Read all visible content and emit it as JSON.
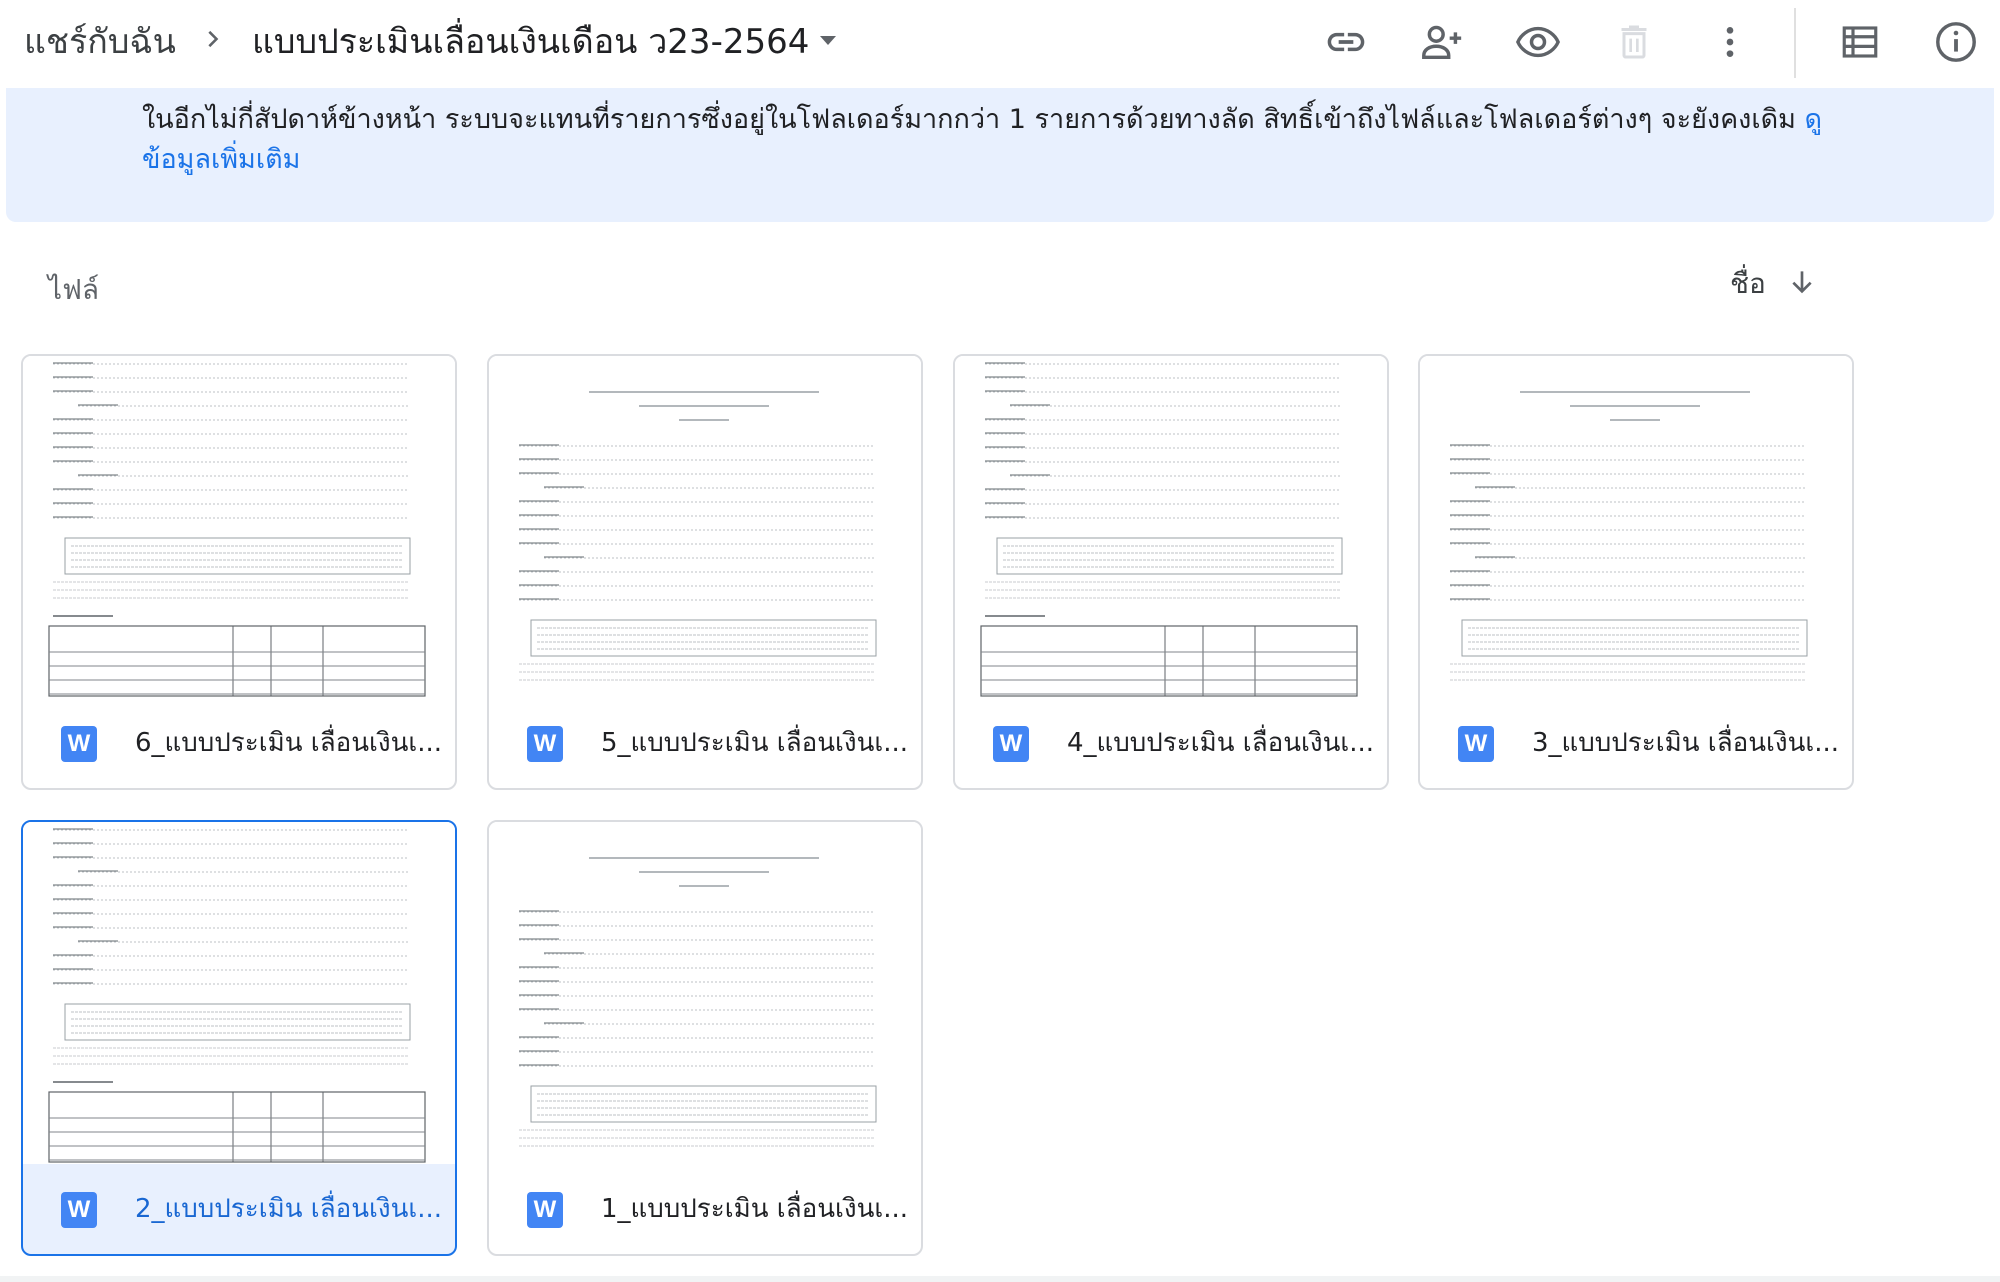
{
  "breadcrumb": {
    "root": "แชร์กับฉัน",
    "current": "แบบประเมินเลื่อนเงินเดือน ว23-2564"
  },
  "toolbar": {
    "icons": [
      "link-icon",
      "add-person-icon",
      "eye-icon",
      "trash-icon",
      "more-vert-icon",
      "list-view-icon",
      "info-icon"
    ]
  },
  "banner": {
    "text": "ในอีกไม่กี่สัปดาห์ข้างหน้า ระบบจะแทนที่รายการซึ่งอยู่ในโฟลเดอร์มากกว่า 1 รายการด้วยทางลัด สิทธิ์เข้าถึงไฟล์และโฟลเดอร์ต่างๆ จะยังคงเดิม ",
    "link": "ดูข้อมูลเพิ่มเติม"
  },
  "section": {
    "label": "ไฟล์",
    "sort_label": "ชื่อ"
  },
  "files": [
    {
      "name": "6_แบบประเมิน เลื่อนเงินเ...",
      "icon_letter": "W",
      "selected": false
    },
    {
      "name": "5_แบบประเมิน เลื่อนเงินเ...",
      "icon_letter": "W",
      "selected": false
    },
    {
      "name": "4_แบบประเมิน เลื่อนเงินเ...",
      "icon_letter": "W",
      "selected": false
    },
    {
      "name": "3_แบบประเมิน เลื่อนเงินเ...",
      "icon_letter": "W",
      "selected": false
    },
    {
      "name": "2_แบบประเมิน เลื่อนเงินเ...",
      "icon_letter": "W",
      "selected": true
    },
    {
      "name": "1_แบบประเมิน เลื่อนเงินเ...",
      "icon_letter": "W",
      "selected": false
    }
  ],
  "colors": {
    "accent": "#1a73e8",
    "banner_bg": "#e8f0fe",
    "word_blue": "#4285f4",
    "border": "#dadce0"
  }
}
